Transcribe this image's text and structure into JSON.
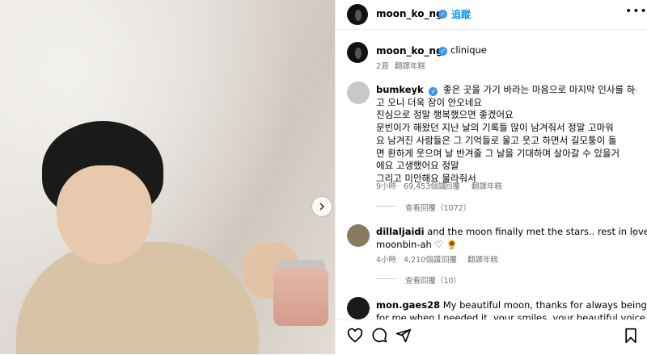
{
  "post_header": {
    "username": "moon_ko_ng",
    "follow_label": "追蹤",
    "more_icon": "more-icon"
  },
  "caption": {
    "username": "moon_ko_ng",
    "text": "clinique",
    "time": "2週",
    "translate_label": "翻譯年糕"
  },
  "comments": [
    {
      "username": "bumkeyk",
      "lines": [
        "좋은 곳을 가기 바라는 마음으로 마지막 인사를 하",
        "고 오니 더욱 잠이 안오네요",
        "진심으로 정말 행복했으면 좋겠어요",
        "문빈이가 해왔던 지난 날의 기록들 많이 남겨줘서 정말 고마워",
        "요 남겨진 사람들은 그 기억들로 울고 웃고 하면서 길모퉁이 돌",
        "면 환하게 웃으며 날 반겨줄 그 날을 기대하며 살아갈 수 있을거",
        "에요 고생했어요 정말",
        "그리고 미안해요 물라줘서"
      ],
      "time": "9小時",
      "likes": "69,453個讚",
      "reply_label": "回覆",
      "translate_label": "翻譯年糕",
      "view_replies": "查看回覆（1072）"
    },
    {
      "username": "dillaljaidi",
      "lines": [
        "and the moon finally met the stars.. rest in love,",
        "moonbin-ah ♡ 🌻"
      ],
      "time": "4小時",
      "likes": "4,210個讚",
      "reply_label": "回覆",
      "translate_label": "翻譯年糕",
      "view_replies": "查看回覆（10）"
    },
    {
      "username": "mon.gaes28",
      "lines": [
        "My beautiful moon, thanks for always being there",
        "for me when I needed it, your smiles, your beautiful voice,"
      ]
    }
  ],
  "colors": {
    "accent": "#0095f6",
    "verified": "#3897f0",
    "muted": "#737373"
  }
}
